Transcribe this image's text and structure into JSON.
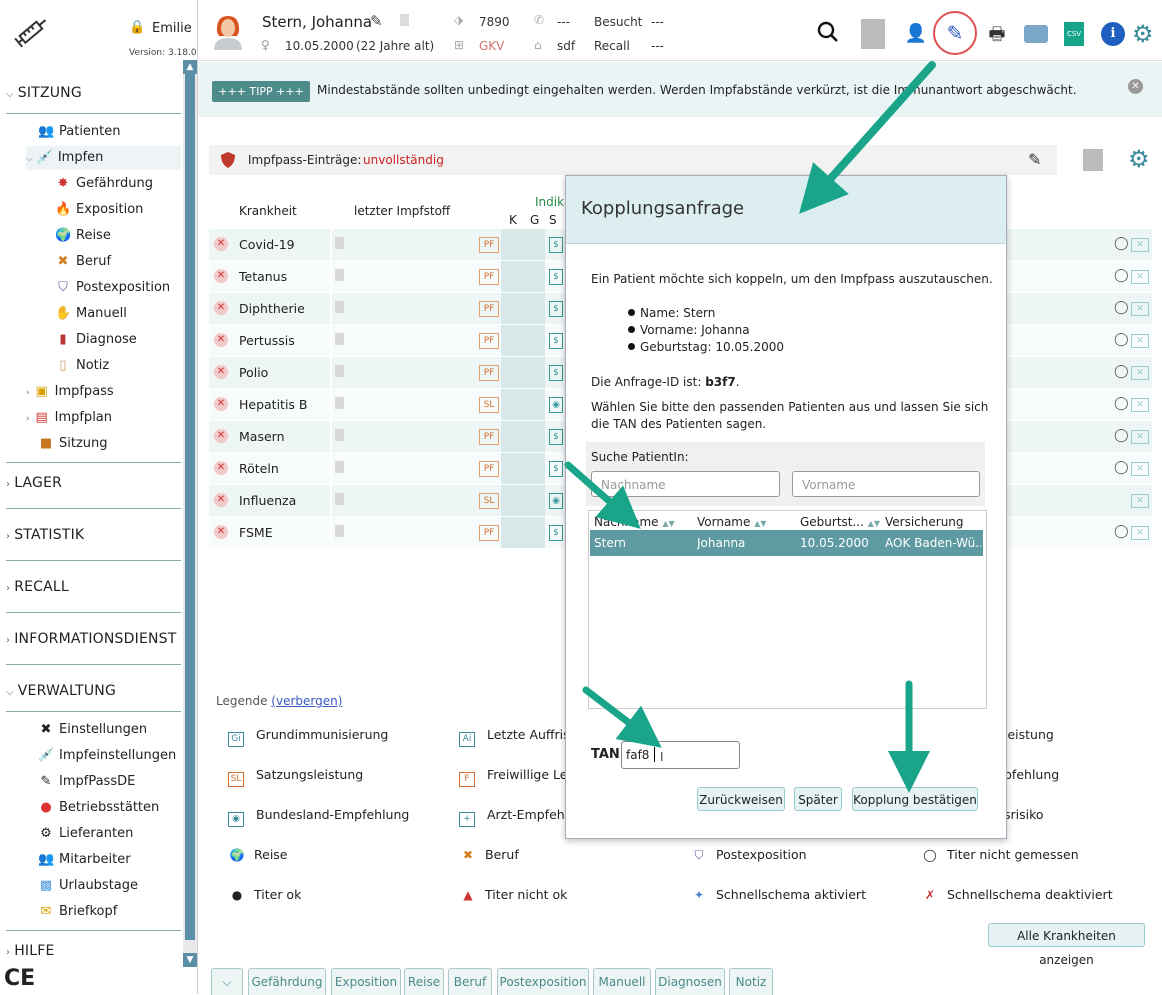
{
  "app": {
    "user": "Emilie",
    "version": "Version: 3.18.0",
    "ce_mark": "CE"
  },
  "sidebar": {
    "sections": [
      {
        "label": "SITZUNG",
        "expanded": true
      },
      {
        "label": "LAGER",
        "expanded": false
      },
      {
        "label": "STATISTIK",
        "expanded": false
      },
      {
        "label": "RECALL",
        "expanded": false
      },
      {
        "label": "INFORMATIONSDIENST",
        "expanded": false
      },
      {
        "label": "VERWALTUNG",
        "expanded": true
      },
      {
        "label": "HILFE",
        "expanded": false
      }
    ],
    "sitzung_items": [
      {
        "label": "Patienten",
        "icon": "patients-icon"
      },
      {
        "label": "Impfen",
        "icon": "syringe-icon"
      },
      {
        "label": "Gefährdung",
        "icon": "virus-icon"
      },
      {
        "label": "Exposition",
        "icon": "fire-icon"
      },
      {
        "label": "Reise",
        "icon": "globe-icon"
      },
      {
        "label": "Beruf",
        "icon": "tools-icon"
      },
      {
        "label": "Postexposition",
        "icon": "shield-virus-icon"
      },
      {
        "label": "Manuell",
        "icon": "hand-icon"
      },
      {
        "label": "Diagnose",
        "icon": "book-icon"
      },
      {
        "label": "Notiz",
        "icon": "note-icon"
      },
      {
        "label": "Impfpass",
        "icon": "passport-icon"
      },
      {
        "label": "Impfplan",
        "icon": "calendar-icon"
      },
      {
        "label": "Sitzung",
        "icon": "briefcase-icon"
      }
    ],
    "verwaltung_items": [
      {
        "label": "Einstellungen",
        "icon": "wrench-icon"
      },
      {
        "label": "Impfeinstellungen",
        "icon": "syringe-settings-icon"
      },
      {
        "label": "ImpfPassDE",
        "icon": "syringe-pen-icon"
      },
      {
        "label": "Betriebsstätten",
        "icon": "location-pin-icon"
      },
      {
        "label": "Lieferanten",
        "icon": "supplier-icon"
      },
      {
        "label": "Mitarbeiter",
        "icon": "staff-icon"
      },
      {
        "label": "Urlaubstage",
        "icon": "vacation-icon"
      },
      {
        "label": "Briefkopf",
        "icon": "envelope-icon"
      }
    ]
  },
  "patient": {
    "name": "Stern, Johanna",
    "birth": "10.05.2000",
    "age": "(22 Jahre alt)",
    "id": "7890",
    "phone": "---",
    "insurance": "GKV",
    "address": "sdf",
    "besucht_label": "Besucht",
    "besucht_value": "---",
    "recall_label": "Recall",
    "recall_value": "---"
  },
  "tip": {
    "badge": "+++ TIPP +++",
    "text": "Mindestabstände sollten unbedingt eingehalten werden. Werden Impfabstände verkürzt, ist die Immunantwort abgeschwächt."
  },
  "impfpass": {
    "label": "Impfpass-Einträge:",
    "status": "unvollständig"
  },
  "table": {
    "col_krankheit": "Krankheit",
    "col_impfstoff": "letzter Impfstoff",
    "col_indik": "Indik",
    "col_k": "K",
    "col_g": "G",
    "col_s": "S",
    "rows": [
      {
        "name": "Covid-19",
        "badge": "PF"
      },
      {
        "name": "Tetanus",
        "badge": "PF"
      },
      {
        "name": "Diphtherie",
        "badge": "PF"
      },
      {
        "name": "Pertussis",
        "badge": "PF"
      },
      {
        "name": "Polio",
        "badge": "PF"
      },
      {
        "name": "Hepatitis B",
        "badge": "SL"
      },
      {
        "name": "Masern",
        "badge": "PF"
      },
      {
        "name": "Röteln",
        "badge": "PF"
      },
      {
        "name": "Influenza",
        "badge": "SL"
      },
      {
        "name": "FSME",
        "badge": "PF"
      }
    ]
  },
  "legend": {
    "title": "Legende",
    "toggle": "(verbergen)",
    "items": [
      {
        "label": "Grundimmunisierung",
        "code": "Gi"
      },
      {
        "label": "Letzte Auffrisc",
        "code": "Ai"
      },
      {
        "label": "leistung",
        "code": ""
      },
      {
        "label": "Satzungsleistung",
        "code": "SL"
      },
      {
        "label": "Freiwillige Lei",
        "code": "F"
      },
      {
        "label": "pfehlung",
        "code": ""
      },
      {
        "label": "Bundesland-Empfehlung",
        "code": ""
      },
      {
        "label": "Arzt-Empfehlu",
        "code": ""
      },
      {
        "label": "srisiko",
        "code": ""
      },
      {
        "label": "Reise",
        "code": ""
      },
      {
        "label": "Beruf",
        "code": ""
      },
      {
        "label": "Postexposition",
        "code": ""
      },
      {
        "label": "Titer nicht gemessen",
        "code": ""
      },
      {
        "label": "Titer ok",
        "code": ""
      },
      {
        "label": "Titer nicht ok",
        "code": ""
      },
      {
        "label": "Schnellschema aktiviert",
        "code": ""
      },
      {
        "label": "Schnellschema deaktiviert",
        "code": ""
      }
    ],
    "show_all_button": "Alle Krankheiten anzeigen"
  },
  "bottom_tabs": [
    "Gefährdung",
    "Exposition",
    "Reise",
    "Beruf",
    "Postexposition",
    "Manuell",
    "Diagnosen",
    "Notiz"
  ],
  "dialog": {
    "title": "Kopplungsanfrage",
    "intro": "Ein Patient möchte sich koppeln, um den Impfpass auszutauschen.",
    "name_line": "Name: Stern",
    "vorname_line": "Vorname: Johanna",
    "geburtstag_line": "Geburtstag: 10.05.2000",
    "request_prefix": "Die Anfrage-ID ist:",
    "request_id": "b3f7",
    "request_suffix": ".",
    "instruction_line1": "Wählen Sie bitte den passenden Patienten aus und lassen Sie sich",
    "instruction_line2": "die TAN des Patienten sagen.",
    "search_label": "Suche PatientIn:",
    "nachname_placeholder": "Nachname",
    "vorname_placeholder": "Vorname",
    "columns": [
      "Nachname",
      "Vorname",
      "Geburtst...",
      "Versicherung"
    ],
    "result": {
      "nachname": "Stern",
      "vorname": "Johanna",
      "geburtstag": "10.05.2000",
      "versicherung": "AOK Baden-Wü..."
    },
    "tan_label": "TAN",
    "tan_value": "faf8",
    "btn_back": "Zurückweisen",
    "btn_later": "Später",
    "btn_confirm": "Kopplung bestätigen"
  },
  "colors": {
    "accent": "#5e9aa2",
    "arrow": "#1aa58a",
    "highlight_circle": "#e05050",
    "error": "#cc2222"
  }
}
